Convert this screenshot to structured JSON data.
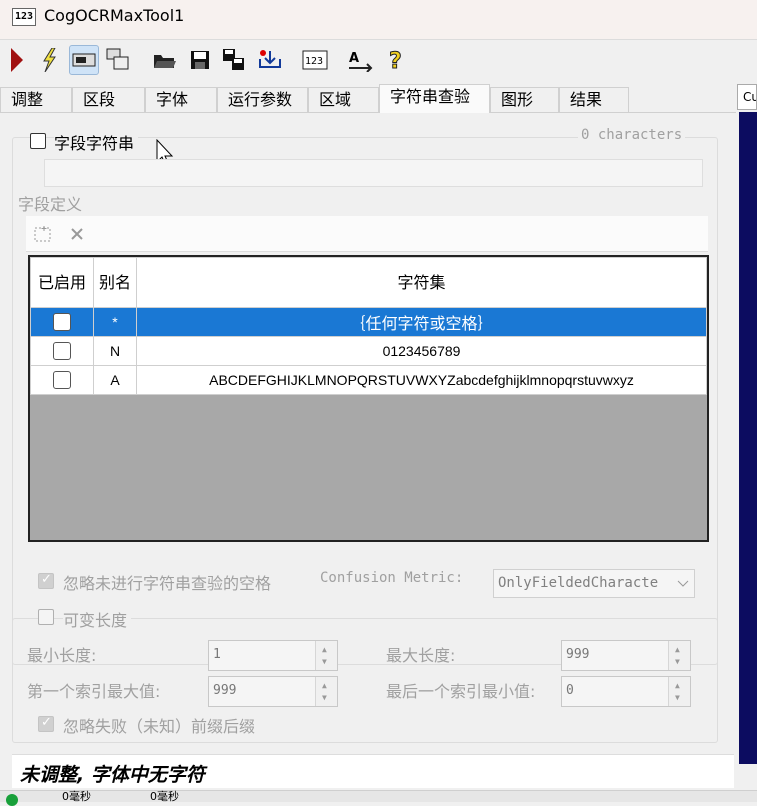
{
  "window": {
    "icon_text": "123",
    "title": "CogOCRMaxTool1"
  },
  "toolbar": {
    "icons": [
      "run-icon",
      "electric-run-icon",
      "display-icon",
      "floating-display-icon",
      "open-icon",
      "save-icon",
      "save-as-icon",
      "reset-icon",
      "ocr-font-icon",
      "train-icon",
      "help-icon"
    ]
  },
  "tabs": [
    "调整",
    "区段",
    "字体",
    "运行参数",
    "区域",
    "字符串查验",
    "图形",
    "结果"
  ],
  "active_tab": "字符串查验",
  "right_panel": {
    "label": "Cu"
  },
  "fielded": {
    "checkbox_label": "字段字符串",
    "char_count": "0 characters",
    "definition_label": "字段定义",
    "table": {
      "headers": [
        "已启用",
        "别名",
        "字符集"
      ],
      "rows": [
        {
          "alias": "*",
          "charset": "｛任何字符或空格｝",
          "selected": true
        },
        {
          "alias": "N",
          "charset": "0123456789",
          "selected": false
        },
        {
          "alias": "A",
          "charset": "ABCDEFGHIJKLMNOPQRSTUVWXYZabcdefghijklmnopqrstuvwxyz",
          "selected": false
        }
      ]
    }
  },
  "options": {
    "ignore_spaces_label": "忽略未进行字符串查验的空格",
    "confusion_label": "Confusion Metric:",
    "confusion_value": "OnlyFieldedCharacte",
    "variable_length_label": "可变长度",
    "min_length_label": "最小长度:",
    "min_length_value": "1",
    "max_length_label": "最大长度:",
    "max_length_value": "999",
    "first_index_label": "第一个索引最大值:",
    "first_index_value": "999",
    "last_index_label": "最后一个索引最小值:",
    "last_index_value": "0",
    "ignore_unknown_label": "忽略失败（未知）前缀后缀"
  },
  "status": {
    "message": "未调整, 字体中无字符"
  },
  "statusbar": {
    "cell1": "0毫秒",
    "cell2": "0毫秒"
  },
  "colors": {
    "selection": "#1a78d4",
    "navy": "#0c0c60",
    "run": "#b01010"
  }
}
